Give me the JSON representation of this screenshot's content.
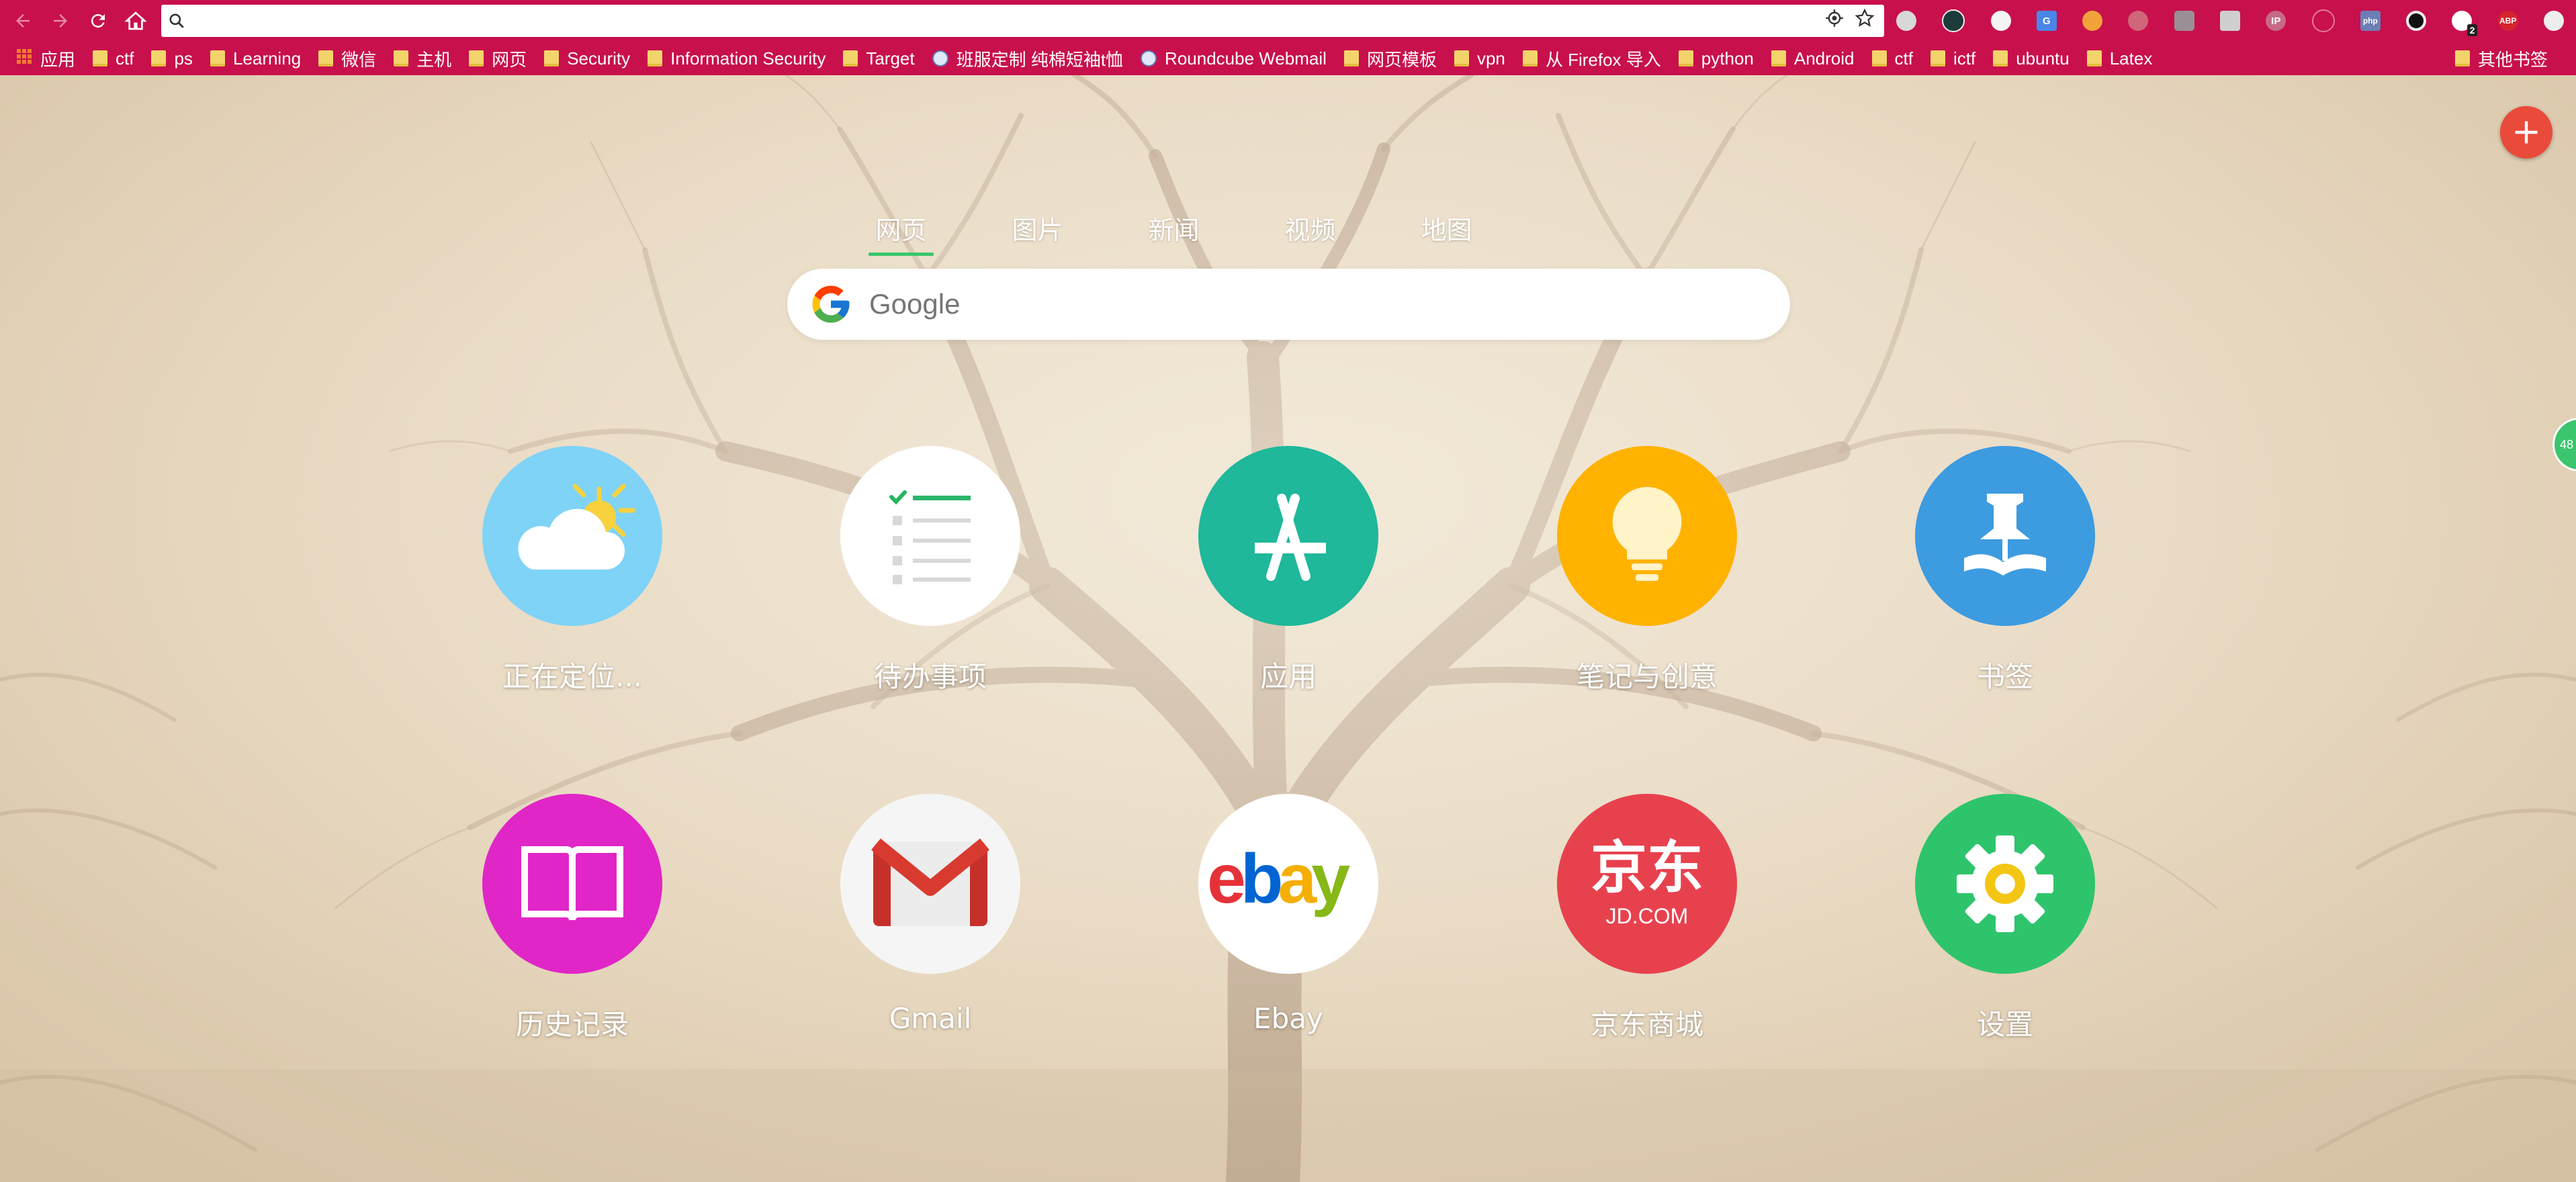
{
  "toolbar": {
    "omnibox_value": "",
    "omnibox_placeholder": ""
  },
  "bookmarks": {
    "items": [
      {
        "label": "应用",
        "icon": "apps-grid-icon"
      },
      {
        "label": "ctf",
        "icon": "folder-icon"
      },
      {
        "label": "ps",
        "icon": "folder-icon"
      },
      {
        "label": "Learning",
        "icon": "folder-icon"
      },
      {
        "label": "微信",
        "icon": "folder-icon"
      },
      {
        "label": "主机",
        "icon": "folder-icon"
      },
      {
        "label": "网页",
        "icon": "folder-icon"
      },
      {
        "label": "Security",
        "icon": "folder-icon"
      },
      {
        "label": "Information Security",
        "icon": "folder-icon"
      },
      {
        "label": "Target",
        "icon": "folder-icon"
      },
      {
        "label": "班服定制 纯棉短袖t恤",
        "icon": "site-favicon"
      },
      {
        "label": "Roundcube Webmail",
        "icon": "site-favicon"
      },
      {
        "label": "网页模板",
        "icon": "folder-icon"
      },
      {
        "label": "vpn",
        "icon": "folder-icon"
      },
      {
        "label": "从 Firefox 导入",
        "icon": "folder-icon"
      },
      {
        "label": "python",
        "icon": "folder-icon"
      },
      {
        "label": "Android",
        "icon": "folder-icon"
      },
      {
        "label": "ctf",
        "icon": "folder-icon"
      },
      {
        "label": "ictf",
        "icon": "folder-icon"
      },
      {
        "label": "ubuntu",
        "icon": "folder-icon"
      },
      {
        "label": "Latex",
        "icon": "folder-icon"
      }
    ],
    "other": "其他书签"
  },
  "extensions": {
    "badge_count": "2",
    "abp_label": "ABP",
    "ip_label": "IP",
    "php_label": "php"
  },
  "search": {
    "tabs": [
      "网页",
      "图片",
      "新闻",
      "视频",
      "地图"
    ],
    "active_tab": "网页",
    "placeholder": "Google"
  },
  "tiles": [
    {
      "label": "正在定位...",
      "icon": "weather-cloud-sun-icon",
      "color": "#7fd3f7"
    },
    {
      "label": "待办事项",
      "icon": "todo-list-icon",
      "color": "#ffffff"
    },
    {
      "label": "应用",
      "icon": "app-store-icon",
      "color": "#1fb89a"
    },
    {
      "label": "笔记与创意",
      "icon": "lightbulb-icon",
      "color": "#ffb300"
    },
    {
      "label": "书签",
      "icon": "bookmark-pin-icon",
      "color": "#3d9be0"
    },
    {
      "label": "历史记录",
      "icon": "open-book-icon",
      "color": "#e026c6"
    },
    {
      "label": "Gmail",
      "icon": "gmail-icon",
      "color": "#f5f5f5"
    },
    {
      "label": "Ebay",
      "icon": "ebay-logo",
      "color": "#ffffff"
    },
    {
      "label": "京东商城",
      "icon": "jd-logo",
      "color": "#e8414e"
    },
    {
      "label": "设置",
      "icon": "gear-icon",
      "color": "#2ec46c"
    }
  ],
  "logos": {
    "ebay": "ebay",
    "jd_cn": "京东",
    "jd_en": "JD.COM"
  },
  "side_widget": "48"
}
